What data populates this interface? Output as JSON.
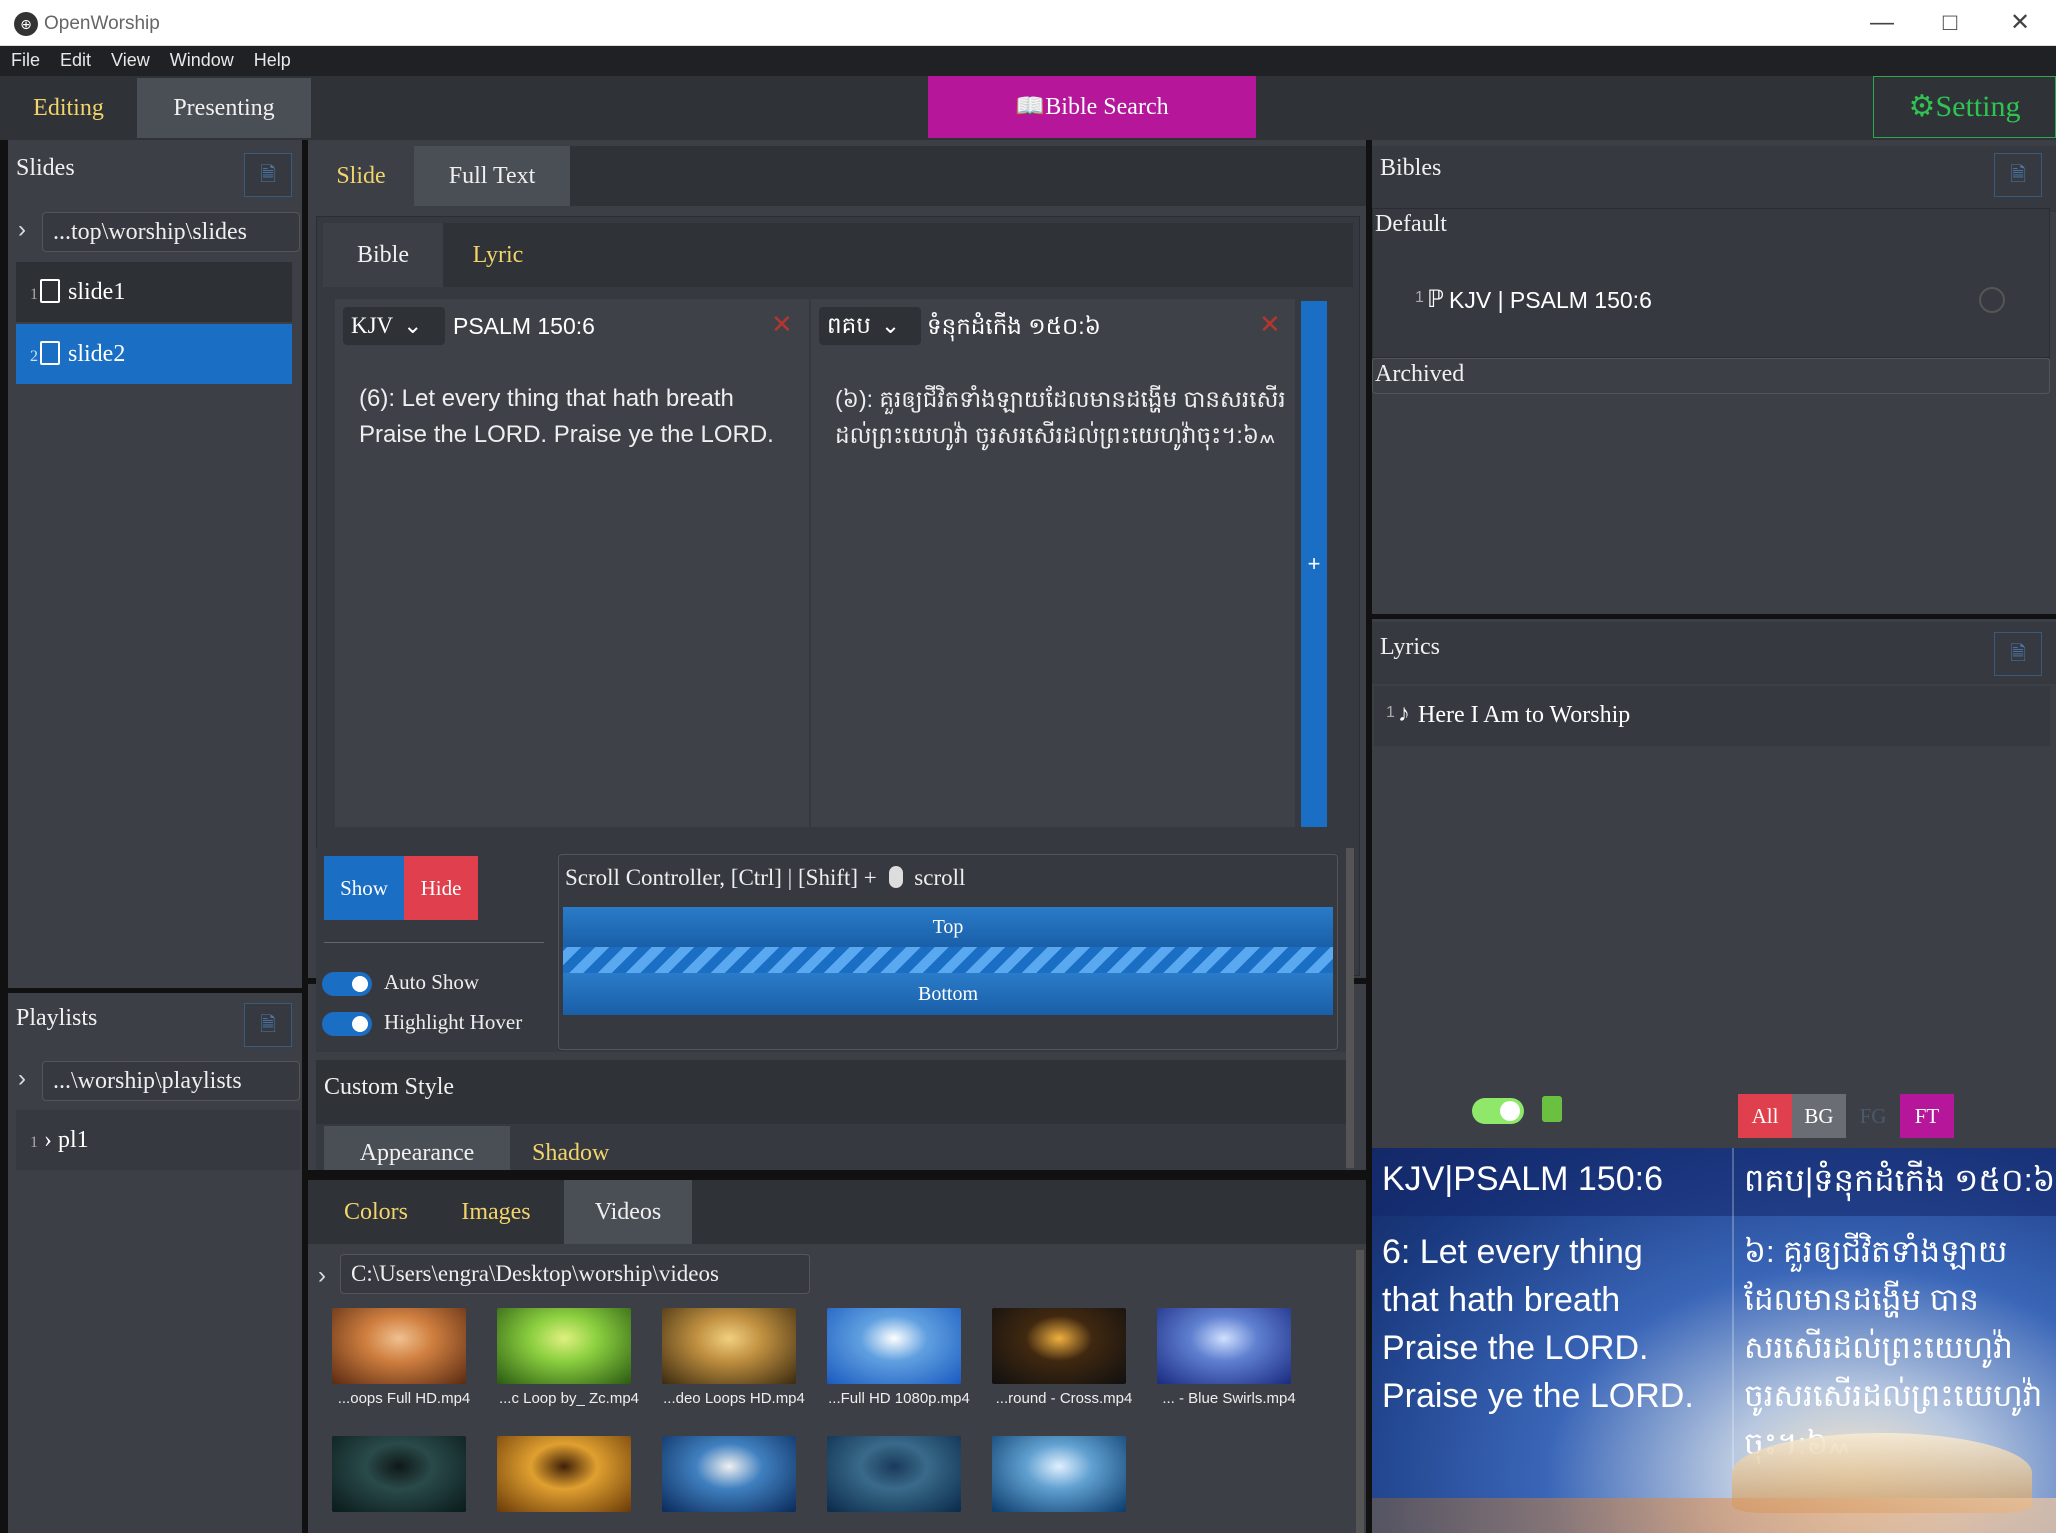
{
  "window": {
    "title": "OpenWorship",
    "icon": "app-logo-icon",
    "controls": [
      "minimize-icon",
      "maximize-icon",
      "close-icon"
    ]
  },
  "menu": [
    "File",
    "Edit",
    "View",
    "Window",
    "Help"
  ],
  "header": {
    "tabs": [
      "Editing",
      "Presenting"
    ],
    "active_tab": "Editing",
    "bible_search": "Bible Search",
    "setting": "Setting"
  },
  "colors": {
    "accent_yellow": "#f2d46b",
    "bible_search_bg": "#b5169a",
    "selected_blue": "#1a6fc4",
    "hide_red": "#e0404e",
    "setting_green": "#2fc352"
  },
  "slides_panel": {
    "title": "Slides",
    "path": "...top\\worship\\slides",
    "items": [
      {
        "num": "1",
        "label": "slide1",
        "selected": false
      },
      {
        "num": "2",
        "label": "slide2",
        "selected": true
      }
    ]
  },
  "playlists_panel": {
    "title": "Playlists",
    "path": "...\\worship\\playlists",
    "items": [
      {
        "num": "1",
        "label": "pl1"
      }
    ]
  },
  "editor": {
    "tabs": [
      "Slide",
      "Full Text"
    ],
    "active_tab": "Slide",
    "sub_tabs": [
      "Bible",
      "Lyric"
    ],
    "active_sub_tab": "Bible",
    "columns": [
      {
        "version": "KJV",
        "reference": "PSALM 150:6",
        "verse_lines": [
          "(6): Let every thing that hath breath",
          "Praise the LORD. Praise ye the LORD."
        ]
      },
      {
        "version": "ពគប",
        "reference": "ទំនុកដំកើង ១៥០:៦",
        "verse_lines": [
          "(៦): គួរឲ្យជីវិតទាំងឡាយដែលមានដង្ហើម បានសរសើរ",
          "ដល់ព្រះយេហូវ៉ា ចូរសរសើរដល់ព្រះយេហូវ៉ាចុះ។:៦៳"
        ]
      }
    ],
    "add_label": "+"
  },
  "controls": {
    "show": "Show",
    "hide": "Hide",
    "auto_show": "Auto Show",
    "highlight_hover": "Highlight Hover",
    "scroll_title": "Scroll Controller, [Ctrl] | [Shift] +",
    "scroll_suffix": "scroll",
    "top": "Top",
    "bottom": "Bottom"
  },
  "custom_style": {
    "title": "Custom Style",
    "tabs": [
      "Appearance",
      "Shadow"
    ]
  },
  "background": {
    "tabs": [
      "Colors",
      "Images",
      "Videos"
    ],
    "active_tab": "Videos",
    "path": "C:\\Users\\engra\\Desktop\\worship\\videos",
    "videos": [
      {
        "label": "...oops Full HD.mp4",
        "colors": [
          "#5a2a12",
          "#d08040",
          "#f0c090"
        ]
      },
      {
        "label": "...c Loop by_ Zc.mp4",
        "colors": [
          "#2a5a12",
          "#8cd040",
          "#e0f080"
        ]
      },
      {
        "label": "...deo Loops HD.mp4",
        "colors": [
          "#3a2a10",
          "#c09040",
          "#f0d080"
        ]
      },
      {
        "label": "...Full HD 1080p.mp4",
        "colors": [
          "#1a5ac0",
          "#60a0e0",
          "#ffffff"
        ]
      },
      {
        "label": "...round - Cross.mp4",
        "colors": [
          "#101010",
          "#402810",
          "#f0b040"
        ]
      },
      {
        "label": "... - Blue Swirls.mp4",
        "colors": [
          "#1a2a80",
          "#6080d0",
          "#d0e0ff"
        ]
      },
      {
        "label": "",
        "colors": [
          "#0a1a1a",
          "#2a4a4a",
          "#101818"
        ]
      },
      {
        "label": "",
        "colors": [
          "#6a3a08",
          "#e0a030",
          "#402008"
        ]
      },
      {
        "label": "",
        "colors": [
          "#0a2a5a",
          "#4080c0",
          "#f0f0f0"
        ]
      },
      {
        "label": "",
        "colors": [
          "#0a2a4a",
          "#3a6a8a",
          "#1a3a5a"
        ]
      },
      {
        "label": "",
        "colors": [
          "#0a3a6a",
          "#60a0d0",
          "#e0f0ff"
        ]
      }
    ]
  },
  "bibles_panel": {
    "title": "Bibles",
    "default_label": "Default",
    "items": [
      {
        "num": "1",
        "label": "KJV | PSALM 150:6"
      }
    ],
    "archived_label": "Archived"
  },
  "lyrics_panel": {
    "title": "Lyrics",
    "items": [
      {
        "num": "1",
        "label": "Here I Am to Worship"
      }
    ]
  },
  "preview": {
    "buttons": [
      "All",
      "BG",
      "FG",
      "FT"
    ],
    "left_header": "KJV|PSALM 150:6",
    "right_header": "ពគប|ទំនុកដំកើង ១៥០:៦",
    "left_lines": [
      "6: Let every thing",
      "that hath breath",
      "Praise the LORD.",
      "Praise ye the LORD."
    ],
    "right_lines": [
      "៦: គួរឲ្យជីវិតទាំងឡាយ",
      "ដែលមានដង្ហើម បាន",
      "សរសើរដល់ព្រះយេហូវ៉ា",
      "ចូរសរសើរដល់ព្រះយេហូវ៉ា",
      "ចុះ។:៦៳"
    ]
  }
}
